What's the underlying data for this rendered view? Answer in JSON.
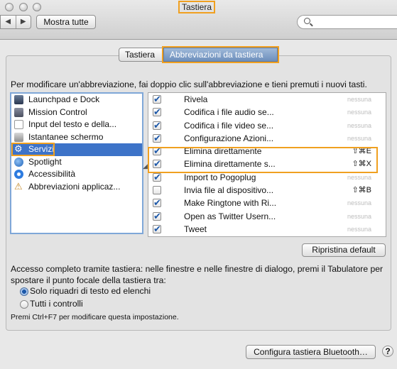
{
  "window": {
    "title": "Tastiera"
  },
  "toolbar": {
    "back": "◀",
    "forward": "▶",
    "show_all": "Mostra tutte",
    "search_placeholder": ""
  },
  "tabs": [
    {
      "label": "Tastiera",
      "active": false
    },
    {
      "label": "Abbreviazioni da tastiera",
      "active": true
    }
  ],
  "instruction": "Per modificare un'abbreviazione, fai doppio clic sull'abbreviazione e tieni premuti i nuovi tasti.",
  "categories": [
    {
      "label": "Launchpad e Dock",
      "icon": "launchpad-dock-icon",
      "selected": false
    },
    {
      "label": "Mission Control",
      "icon": "mission-control-icon",
      "selected": false
    },
    {
      "label": "Input del testo e della...",
      "icon": "text-input-icon",
      "selected": false
    },
    {
      "label": "Istantanee schermo",
      "icon": "screenshot-icon",
      "selected": false
    },
    {
      "label": "Servizi",
      "icon": "gear-icon",
      "selected": true
    },
    {
      "label": "Spotlight",
      "icon": "spotlight-icon",
      "selected": false
    },
    {
      "label": "Accessibilità",
      "icon": "accessibility-icon",
      "selected": false
    },
    {
      "label": "Abbreviazioni applicaz...",
      "icon": "app-shortcuts-icon",
      "selected": false
    }
  ],
  "services": [
    {
      "name": "Rivela",
      "checked": true,
      "shortcut": "nessuna",
      "none": true
    },
    {
      "name": "Codifica i file audio se...",
      "checked": true,
      "shortcut": "nessuna",
      "none": true
    },
    {
      "name": "Codifica i file video se...",
      "checked": true,
      "shortcut": "nessuna",
      "none": true
    },
    {
      "name": "Configurazione Azioni...",
      "checked": true,
      "shortcut": "nessuna",
      "none": true
    },
    {
      "name": "Elimina direttamente",
      "checked": true,
      "shortcut": "⇧⌘E",
      "none": false
    },
    {
      "name": "Elimina direttamente s...",
      "checked": true,
      "shortcut": "⇧⌘X",
      "none": false
    },
    {
      "name": "Import to Pogoplug",
      "checked": true,
      "shortcut": "nessuna",
      "none": true
    },
    {
      "name": "Invia file al dispositivo...",
      "checked": false,
      "shortcut": "⇧⌘B",
      "none": false
    },
    {
      "name": "Make Ringtone with Ri...",
      "checked": true,
      "shortcut": "nessuna",
      "none": true
    },
    {
      "name": "Open as Twitter Usern...",
      "checked": true,
      "shortcut": "nessuna",
      "none": true
    },
    {
      "name": "Tweet",
      "checked": true,
      "shortcut": "nessuna",
      "none": true
    }
  ],
  "restore_default": "Ripristina default",
  "full_access_text": "Accesso completo tramite tastiera: nelle finestre e nelle finestre di dialogo, premi il Tabulatore per spostare il punto focale della tastiera tra:",
  "radio_options": [
    {
      "label": "Solo riquadri di testo ed elenchi",
      "selected": true
    },
    {
      "label": "Tutti i controlli",
      "selected": false
    }
  ],
  "hint": "Premi Ctrl+F7 per modificare questa impostazione.",
  "bluetooth_button": "Configura tastiera Bluetooth…",
  "help": "?",
  "colors": {
    "highlight": "#f0a020",
    "selection": "#3d73c8",
    "check": "#1d58a8"
  }
}
